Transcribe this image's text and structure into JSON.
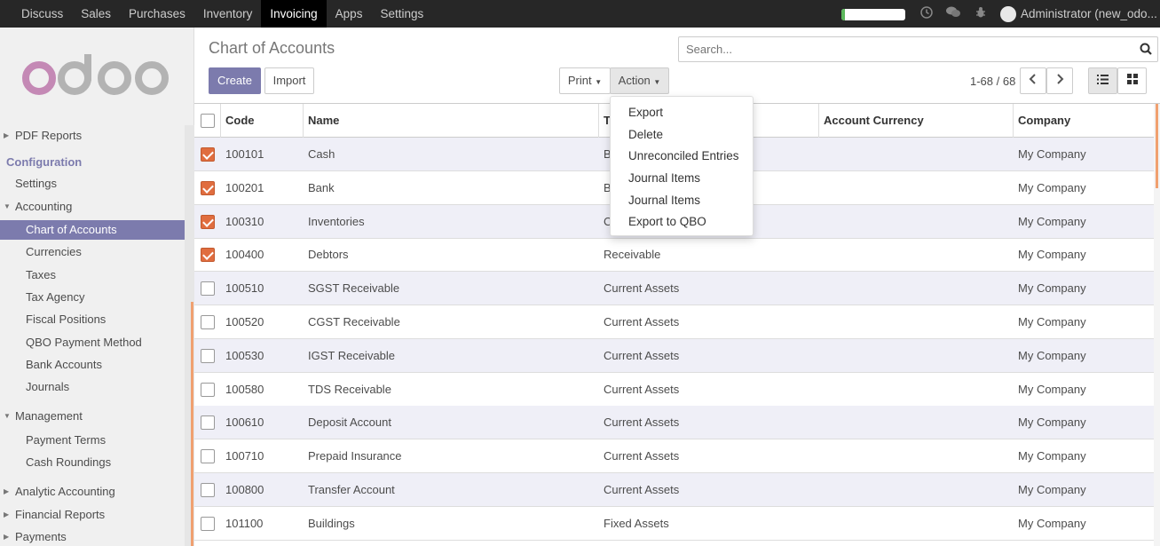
{
  "topbar": {
    "menu": [
      "Discuss",
      "Sales",
      "Purchases",
      "Inventory",
      "Invoicing",
      "Apps",
      "Settings"
    ],
    "active_menu": "Invoicing",
    "progress_fraction": 0.05,
    "user": "Administrator (new_odo..."
  },
  "sidebar": {
    "logo_text": "odoo",
    "items": [
      {
        "label": "PDF Reports",
        "level": 0,
        "caret": "right"
      },
      {
        "label": "Configuration",
        "level": "section"
      },
      {
        "label": "Settings",
        "level": 0
      },
      {
        "label": "Accounting",
        "level": 0,
        "caret": "down"
      },
      {
        "label": "Chart of Accounts",
        "level": 1,
        "active": true
      },
      {
        "label": "Currencies",
        "level": 1
      },
      {
        "label": "Taxes",
        "level": 1
      },
      {
        "label": "Tax Agency",
        "level": 1
      },
      {
        "label": "Fiscal Positions",
        "level": 1
      },
      {
        "label": "QBO Payment Method",
        "level": 1
      },
      {
        "label": "Bank Accounts",
        "level": 1
      },
      {
        "label": "Journals",
        "level": 1
      },
      {
        "label": "Management",
        "level": 0,
        "caret": "down"
      },
      {
        "label": "Payment Terms",
        "level": 1
      },
      {
        "label": "Cash Roundings",
        "level": 1
      },
      {
        "label": "Analytic Accounting",
        "level": 0,
        "caret": "right"
      },
      {
        "label": "Financial Reports",
        "level": 0,
        "caret": "right"
      },
      {
        "label": "Payments",
        "level": 0,
        "caret": "right"
      }
    ]
  },
  "control": {
    "title": "Chart of Accounts",
    "create_label": "Create",
    "import_label": "Import",
    "print_label": "Print",
    "action_label": "Action",
    "search_placeholder": "Search...",
    "pager": "1-68 / 68"
  },
  "action_menu": [
    "Export",
    "Delete",
    "Unreconciled Entries",
    "Journal Items",
    "Journal Items",
    "Export to QBO"
  ],
  "table": {
    "columns": [
      "Code",
      "Name",
      "T",
      "Account Currency",
      "Company"
    ],
    "rows": [
      {
        "checked": true,
        "code": "100101",
        "name": "Cash",
        "type": "B",
        "currency": "",
        "company": "My Company"
      },
      {
        "checked": true,
        "code": "100201",
        "name": "Bank",
        "type": "B",
        "currency": "",
        "company": "My Company"
      },
      {
        "checked": true,
        "code": "100310",
        "name": "Inventories",
        "type": "C",
        "currency": "",
        "company": "My Company"
      },
      {
        "checked": true,
        "code": "100400",
        "name": "Debtors",
        "type": "Receivable",
        "currency": "",
        "company": "My Company"
      },
      {
        "checked": false,
        "code": "100510",
        "name": "SGST Receivable",
        "type": "Current Assets",
        "currency": "",
        "company": "My Company"
      },
      {
        "checked": false,
        "code": "100520",
        "name": "CGST Receivable",
        "type": "Current Assets",
        "currency": "",
        "company": "My Company"
      },
      {
        "checked": false,
        "code": "100530",
        "name": "IGST Receivable",
        "type": "Current Assets",
        "currency": "",
        "company": "My Company"
      },
      {
        "checked": false,
        "code": "100580",
        "name": "TDS Receivable",
        "type": "Current Assets",
        "currency": "",
        "company": "My Company"
      },
      {
        "checked": false,
        "code": "100610",
        "name": "Deposit Account",
        "type": "Current Assets",
        "currency": "",
        "company": "My Company"
      },
      {
        "checked": false,
        "code": "100710",
        "name": "Prepaid Insurance",
        "type": "Current Assets",
        "currency": "",
        "company": "My Company"
      },
      {
        "checked": false,
        "code": "100800",
        "name": "Transfer Account",
        "type": "Current Assets",
        "currency": "",
        "company": "My Company"
      },
      {
        "checked": false,
        "code": "101100",
        "name": "Buildings",
        "type": "Fixed Assets",
        "currency": "",
        "company": "My Company"
      }
    ]
  },
  "colors": {
    "brand": "#7c7bad",
    "checkbox_checked": "#e06d3f",
    "topbar": "#272727"
  }
}
